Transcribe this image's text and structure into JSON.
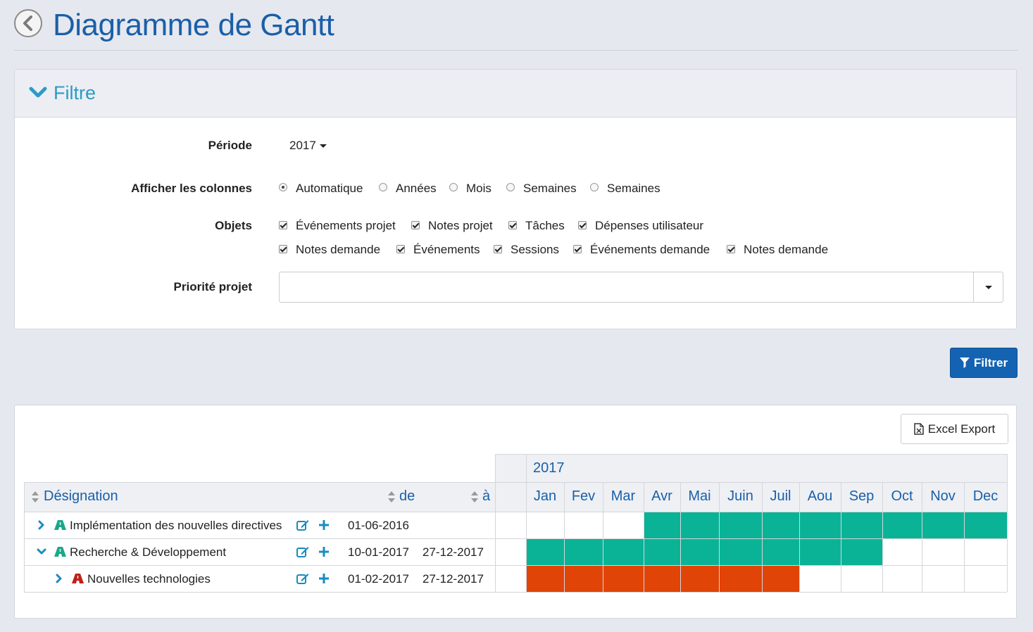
{
  "header": {
    "title": "Diagramme de Gantt"
  },
  "filter": {
    "heading": "Filtre",
    "periode": {
      "label": "Période",
      "value": "2017"
    },
    "colonnes": {
      "label": "Afficher les colonnes",
      "options": [
        "Automatique",
        "Années",
        "Mois",
        "Semaines",
        "Semaines"
      ],
      "selected": "Automatique"
    },
    "objets": {
      "label": "Objets",
      "row1": [
        "Événements projet",
        "Notes projet",
        "Tâches",
        "Dépenses utilisateur"
      ],
      "row2": [
        "Notes demande",
        "Événements",
        "Sessions",
        "Événements demande",
        "Notes demande"
      ]
    },
    "priorite": {
      "label": "Priorité projet",
      "value": ""
    },
    "button": "Filtrer"
  },
  "gantt": {
    "export_label": "Excel Export",
    "year": "2017",
    "columns": {
      "designation": "Désignation",
      "de": "de",
      "a": "à"
    },
    "months": [
      "Jan",
      "Fev",
      "Mar",
      "Avr",
      "Mai",
      "Juin",
      "Juil",
      "Aou",
      "Sep",
      "Oct",
      "Nov",
      "Dec"
    ],
    "colors": {
      "teal": "#0ab396",
      "orange": "#e04406"
    },
    "rows": [
      {
        "name": "Implémentation des nouvelles directives",
        "de": "01-06-2016",
        "a": "",
        "level": 0,
        "expanded": false,
        "icon_color": "#1aa88a",
        "bar_start": 3,
        "bar_end": 11,
        "bar_color": "#0ab396"
      },
      {
        "name": "Recherche & Développement",
        "de": "10-01-2017",
        "a": "27-12-2017",
        "level": 0,
        "expanded": true,
        "icon_color": "#1aa88a",
        "bar_start": 0,
        "bar_end": 8,
        "bar_color": "#0ab396"
      },
      {
        "name": "Nouvelles technologies",
        "de": "01-02-2017",
        "a": "27-12-2017",
        "level": 1,
        "expanded": false,
        "icon_color": "#c0201a",
        "bar_start": 0,
        "bar_end": 6,
        "bar_color": "#e04406"
      }
    ]
  }
}
